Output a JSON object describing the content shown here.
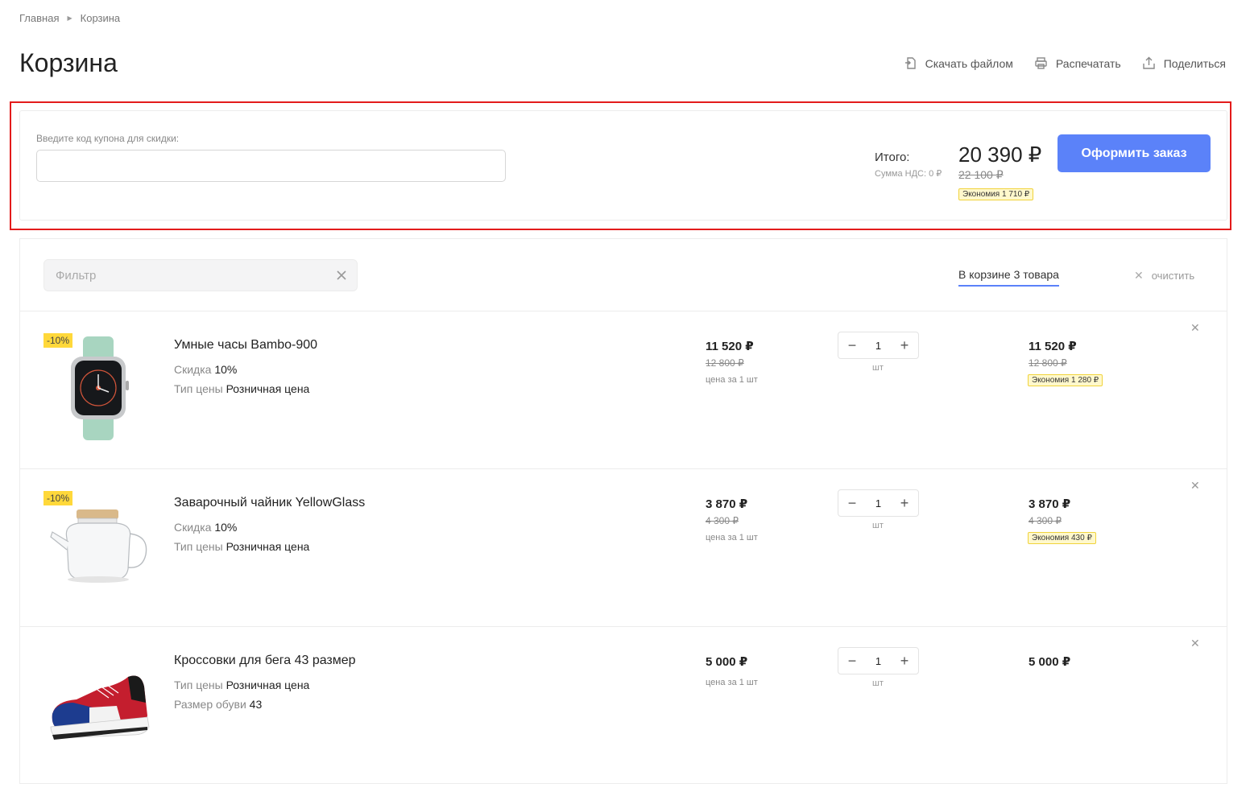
{
  "breadcrumb": {
    "home": "Главная",
    "current": "Корзина"
  },
  "page_title": "Корзина",
  "actions": {
    "download": "Скачать файлом",
    "print": "Распечатать",
    "share": "Поделиться"
  },
  "summary": {
    "coupon_label": "Введите код купона для скидки:",
    "coupon_value": "",
    "total_label": "Итого:",
    "vat_label": "Сумма НДС: 0 ₽",
    "total_price": "20 390 ₽",
    "total_old_price": "22 100 ₽",
    "savings": "Экономия  1 710 ₽",
    "checkout_label": "Оформить заказ"
  },
  "cart": {
    "filter_placeholder": "Фильтр",
    "count_label": "В корзине 3 товара",
    "clear_label": "очистить",
    "items": [
      {
        "discount_badge": "-10%",
        "name": "Умные часы Bambo-900",
        "prop1_label": "Скидка",
        "prop1_value": "10%",
        "prop2_label": "Тип цены",
        "prop2_value": "Розничная цена",
        "price": "11 520 ₽",
        "old_price": "12 800 ₽",
        "unit_note": "цена за 1 шт",
        "quantity": "1",
        "unit": "шт",
        "sum": "11 520 ₽",
        "sum_old": "12 800 ₽",
        "savings": "Экономия  1 280 ₽"
      },
      {
        "discount_badge": "-10%",
        "name": "Заварочный чайник YellowGlass",
        "prop1_label": "Скидка",
        "prop1_value": "10%",
        "prop2_label": "Тип цены",
        "prop2_value": "Розничная цена",
        "price": "3 870 ₽",
        "old_price": "4 300 ₽",
        "unit_note": "цена за 1 шт",
        "quantity": "1",
        "unit": "шт",
        "sum": "3 870 ₽",
        "sum_old": "4 300 ₽",
        "savings": "Экономия  430 ₽"
      },
      {
        "name": "Кроссовки для бега 43 размер",
        "prop1_label": "Тип цены",
        "prop1_value": "Розничная цена",
        "prop2_label": "Размер обуви",
        "prop2_value": "43",
        "price": "5 000 ₽",
        "unit_note": "цена за 1 шт",
        "quantity": "1",
        "unit": "шт",
        "sum": "5 000 ₽"
      }
    ]
  },
  "colors": {
    "accent": "#5b82f9",
    "highlight_frame": "#e31b1b",
    "badge": "#ffd83a",
    "savings_bg": "#fff8cc"
  }
}
